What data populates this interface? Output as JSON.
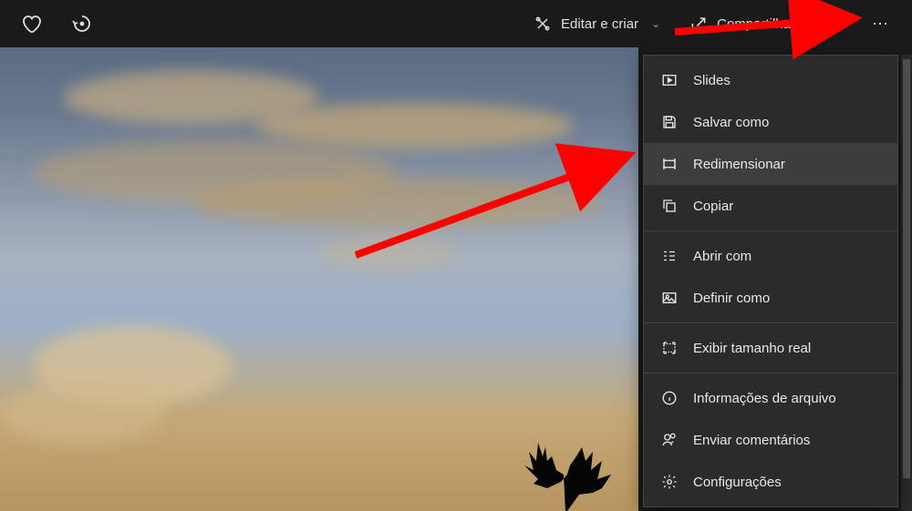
{
  "toolbar": {
    "edit_label": "Editar e criar",
    "share_label": "Compartilhar"
  },
  "menu": {
    "items": [
      {
        "label": "Slides",
        "icon": "slideshow"
      },
      {
        "label": "Salvar como",
        "icon": "save"
      },
      {
        "label": "Redimensionar",
        "icon": "resize",
        "highlighted": true
      },
      {
        "label": "Copiar",
        "icon": "copy"
      }
    ],
    "group2": [
      {
        "label": "Abrir com",
        "icon": "open-with"
      },
      {
        "label": "Definir como",
        "icon": "set-as"
      }
    ],
    "group3": [
      {
        "label": "Exibir tamanho real",
        "icon": "actual-size"
      }
    ],
    "group4": [
      {
        "label": "Informações de arquivo",
        "icon": "info"
      },
      {
        "label": "Enviar comentários",
        "icon": "feedback"
      },
      {
        "label": "Configurações",
        "icon": "settings"
      }
    ]
  }
}
